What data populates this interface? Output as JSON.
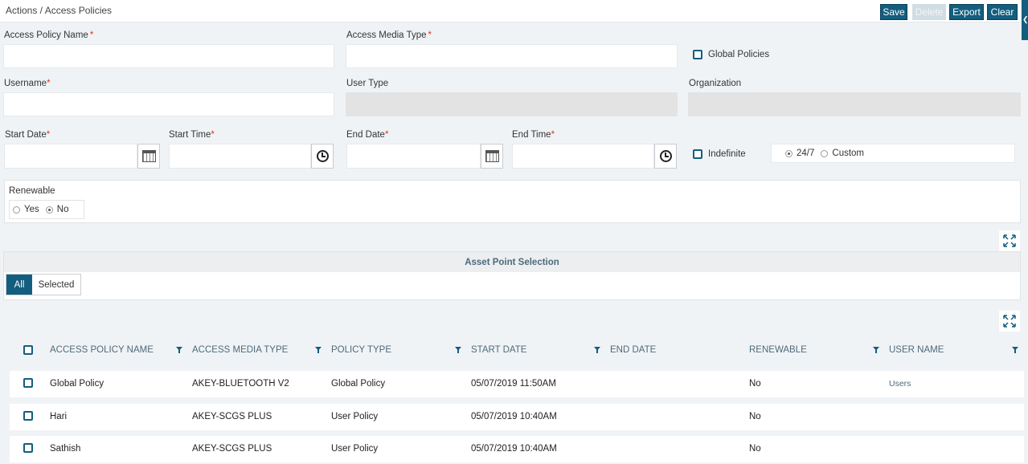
{
  "header": {
    "breadcrumb": "Actions / Access Policies",
    "buttons": {
      "save": "Save",
      "delete": "Delete",
      "export": "Export",
      "clear": "Clear"
    },
    "side_tab_icon": "chevron-left-icon"
  },
  "form": {
    "access_policy_name": {
      "label": "Access Policy Name",
      "required": "*",
      "value": ""
    },
    "access_media_type": {
      "label": "Access Media Type",
      "required": "*",
      "value": ""
    },
    "global_policies": {
      "label": "Global Policies",
      "checked": false
    },
    "username": {
      "label": "Username",
      "required": "*",
      "value": ""
    },
    "user_type": {
      "label": "User Type",
      "value": ""
    },
    "organization": {
      "label": "Organization",
      "value": ""
    },
    "start_date": {
      "label": "Start Date",
      "required": "*",
      "value": ""
    },
    "start_time": {
      "label": "Start Time",
      "required": "*",
      "value": ""
    },
    "end_date": {
      "label": "End Date",
      "required": "*",
      "value": ""
    },
    "end_time": {
      "label": "End Time",
      "required": "*",
      "value": ""
    },
    "indefinite": {
      "label": "Indefinite",
      "checked": false
    },
    "schedule": {
      "opt1": "24/7",
      "opt2": "Custom",
      "selected": "24/7"
    },
    "renewable": {
      "label": "Renewable",
      "yes": "Yes",
      "no": "No",
      "selected": "No"
    }
  },
  "asset_panel": {
    "title": "Asset Point Selection",
    "all": "All",
    "selected": "Selected",
    "active_tab": "All"
  },
  "table": {
    "columns": [
      "ACCESS POLICY NAME",
      "ACCESS MEDIA TYPE",
      "POLICY TYPE",
      "START DATE",
      "END DATE",
      "RENEWABLE",
      "USER NAME"
    ],
    "rows": [
      {
        "name": "Global Policy",
        "media": "AKEY-BLUETOOTH V2",
        "type": "Global Policy",
        "start": "05/07/2019 11:50AM",
        "end": "",
        "renewable": "No",
        "user": "Users"
      },
      {
        "name": "Hari",
        "media": "AKEY-SCGS PLUS",
        "type": "User Policy",
        "start": "05/07/2019 10:40AM",
        "end": "",
        "renewable": "No",
        "user": ""
      },
      {
        "name": "Sathish",
        "media": "AKEY-SCGS PLUS",
        "type": "User Policy",
        "start": "05/07/2019 10:40AM",
        "end": "",
        "renewable": "No",
        "user": ""
      }
    ]
  },
  "colors": {
    "accent": "#135e7e",
    "required": "#d9372a",
    "header_text": "#4d6a7a"
  }
}
